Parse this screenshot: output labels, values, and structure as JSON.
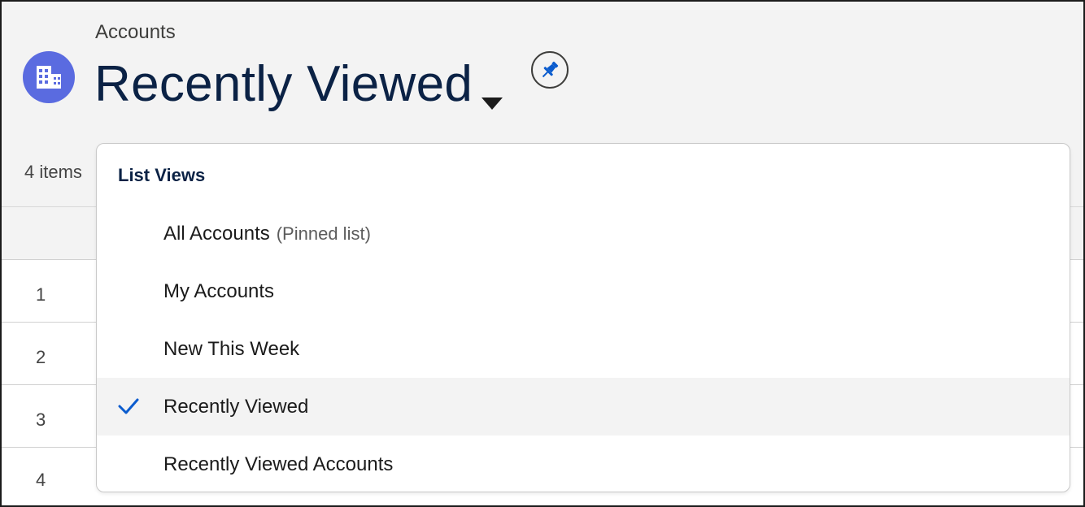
{
  "header": {
    "breadcrumb": "Accounts",
    "title": "Recently Viewed",
    "object_icon": "building-icon",
    "pin_icon": "pin-icon",
    "item_count": "4 items"
  },
  "table": {
    "rows": [
      "1",
      "2",
      "3",
      "4"
    ]
  },
  "list_views": {
    "heading": "List Views",
    "options": [
      {
        "label": "All Accounts",
        "suffix": "(Pinned list)",
        "selected": false
      },
      {
        "label": "My Accounts",
        "suffix": "",
        "selected": false
      },
      {
        "label": "New This Week",
        "suffix": "",
        "selected": false
      },
      {
        "label": "Recently Viewed",
        "suffix": "",
        "selected": true
      },
      {
        "label": "Recently Viewed Accounts",
        "suffix": "",
        "selected": false
      }
    ]
  },
  "colors": {
    "icon_bg": "#5a6be0",
    "title": "#0b2245",
    "accent": "#0b5cce"
  }
}
